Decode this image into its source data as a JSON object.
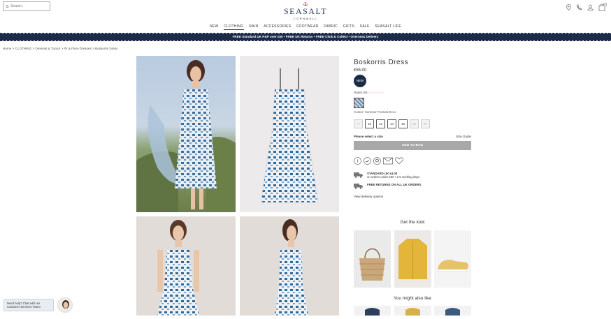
{
  "header": {
    "search_placeholder": "Search...",
    "brand": "SEASALT",
    "brand_sub": "CORNWALL",
    "bag_count": "0"
  },
  "nav": [
    "NEW",
    "CLOTHING",
    "RAIN",
    "ACCESSORIES",
    "FOOTWEAR",
    "FABRIC",
    "GIFTS",
    "SALE",
    "SEASALT LIFE"
  ],
  "promo": "FREE Standard UK P&P over £50 • FREE UK Returns • FREE Click & Collect • Overseas Delivery",
  "breadcrumb": "Home > CLOTHING > Dresses & Tunics > Fit & Flare Dresses > Boskorris Dress",
  "product": {
    "title": "Boskorris Dress",
    "price": "£55.00",
    "badge": "NEW",
    "rated_label": "Rated 0/5",
    "stars": "☆☆☆☆☆",
    "colour": "Colour: Summer Festival Ecru",
    "sizes": [
      {
        "label": "8",
        "available": false
      },
      {
        "label": "10",
        "available": true
      },
      {
        "label": "12",
        "available": true
      },
      {
        "label": "14",
        "available": true
      },
      {
        "label": "16",
        "available": true
      },
      {
        "label": "18",
        "available": false
      },
      {
        "label": "20",
        "available": false
      }
    ],
    "select_size": "Please select a size",
    "size_guide": "Size Guide",
    "add_to_bag": "ADD TO BAG",
    "shipping_title": "STANDARD UK £4.00",
    "shipping_sub": "on orders under £50 • 2-5 working days",
    "returns": "FREE RETURNS ON ALL UK ORDERS",
    "delivery_options": "View delivery options"
  },
  "get_the_look": "Get the look",
  "you_might_also_like": "You might also like",
  "chat": "Need help? Chat with our Customer Services Team!",
  "colors": {
    "navy": "#1c2b47",
    "button_grey": "#a8a8a8"
  }
}
